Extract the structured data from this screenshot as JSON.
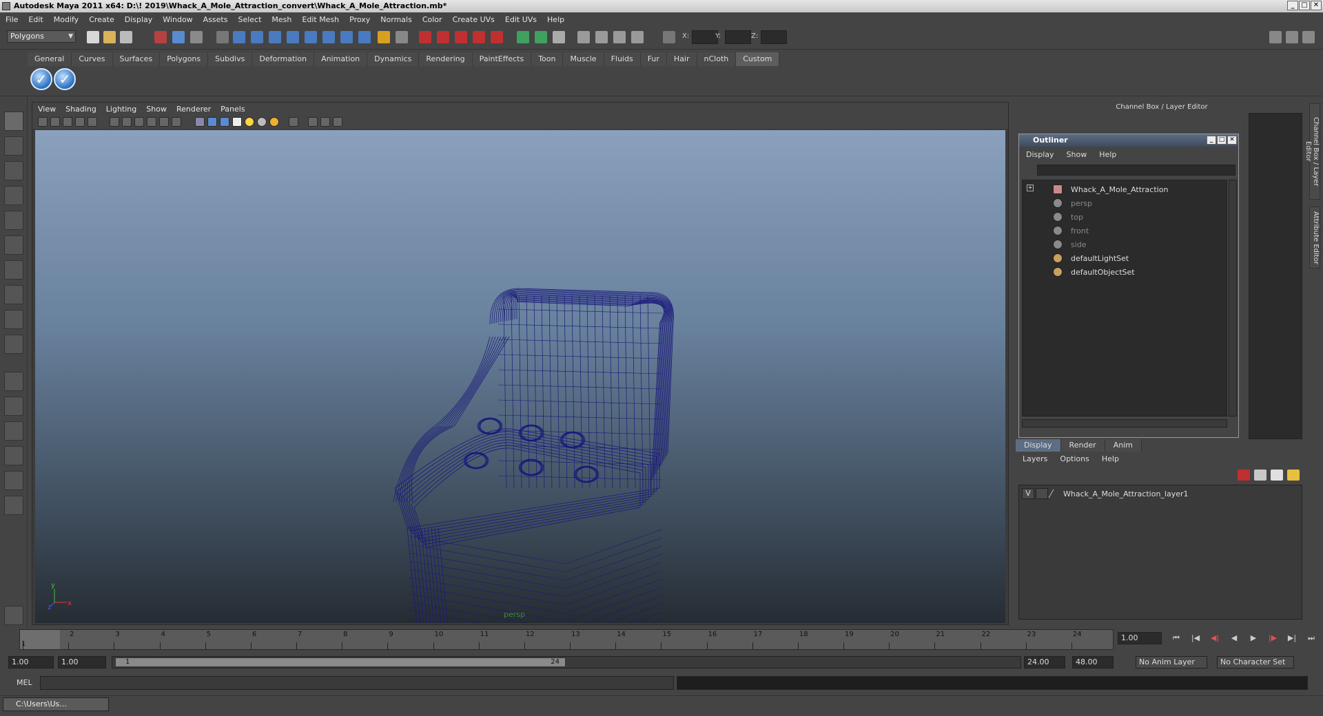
{
  "window": {
    "title": "Autodesk Maya 2011 x64: D:\\! 2019\\Whack_A_Mole_Attraction_convert\\Whack_A_Mole_Attraction.mb*",
    "buttons": [
      "_",
      "□",
      "✕"
    ]
  },
  "main_menu": [
    "File",
    "Edit",
    "Modify",
    "Create",
    "Display",
    "Window",
    "Assets",
    "Select",
    "Mesh",
    "Edit Mesh",
    "Proxy",
    "Normals",
    "Color",
    "Create UVs",
    "Edit UVs",
    "Help"
  ],
  "status_line": {
    "mode": "Polygons",
    "x_label": "X:",
    "y_label": "Y:",
    "z_label": "Z:"
  },
  "shelf": {
    "tabs": [
      "General",
      "Curves",
      "Surfaces",
      "Polygons",
      "Subdivs",
      "Deformation",
      "Animation",
      "Dynamics",
      "Rendering",
      "PaintEffects",
      "Toon",
      "Muscle",
      "Fluids",
      "Fur",
      "Hair",
      "nCloth",
      "Custom"
    ],
    "active_tab": "Custom",
    "buttons": [
      "check-icon",
      "check-icon"
    ]
  },
  "viewport": {
    "menu": [
      "View",
      "Shading",
      "Lighting",
      "Show",
      "Renderer",
      "Panels"
    ],
    "camera_label": "persp",
    "axis": {
      "y": "y",
      "x": "x",
      "z": "z"
    },
    "wire_color": "#1a1a7a"
  },
  "right_panel": {
    "header": "Channel Box / Layer Editor",
    "side_tabs": [
      "Channel Box / Layer Editor",
      "Attribute Editor"
    ]
  },
  "outliner": {
    "title": "Outliner",
    "menu": [
      "Display",
      "Show",
      "Help"
    ],
    "items": [
      {
        "label": "Whack_A_Mole_Attraction",
        "icon": "mesh-transform-icon",
        "dim": false,
        "expandable": true
      },
      {
        "label": "persp",
        "icon": "camera-icon",
        "dim": true
      },
      {
        "label": "top",
        "icon": "camera-icon",
        "dim": true
      },
      {
        "label": "front",
        "icon": "camera-icon",
        "dim": true
      },
      {
        "label": "side",
        "icon": "camera-icon",
        "dim": true
      },
      {
        "label": "defaultLightSet",
        "icon": "set-icon",
        "dim": false
      },
      {
        "label": "defaultObjectSet",
        "icon": "set-icon",
        "dim": false
      }
    ]
  },
  "layer_editor": {
    "tabs": [
      "Display",
      "Render",
      "Anim"
    ],
    "active_tab": "Display",
    "menu": [
      "Layers",
      "Options",
      "Help"
    ],
    "layers": [
      {
        "visible": "V",
        "name": "Whack_A_Mole_Attraction_layer1"
      }
    ]
  },
  "time_slider": {
    "ticks": [
      "1",
      "2",
      "3",
      "4",
      "5",
      "6",
      "7",
      "8",
      "9",
      "10",
      "11",
      "12",
      "13",
      "14",
      "15",
      "16",
      "17",
      "18",
      "19",
      "20",
      "21",
      "22",
      "23",
      "24"
    ],
    "current_frame_label": "1",
    "current_frame": "1.00"
  },
  "range_slider": {
    "start_time": "1.00",
    "playback_start": "1.00",
    "handle_start": "1",
    "handle_end": "24",
    "playback_end": "24.00",
    "end_time": "48.00",
    "anim_layer": "No Anim Layer",
    "character_set": "No Character Set"
  },
  "command_line": {
    "label": "MEL"
  },
  "taskbar": {
    "item": "C:\\Users\\Us..."
  }
}
